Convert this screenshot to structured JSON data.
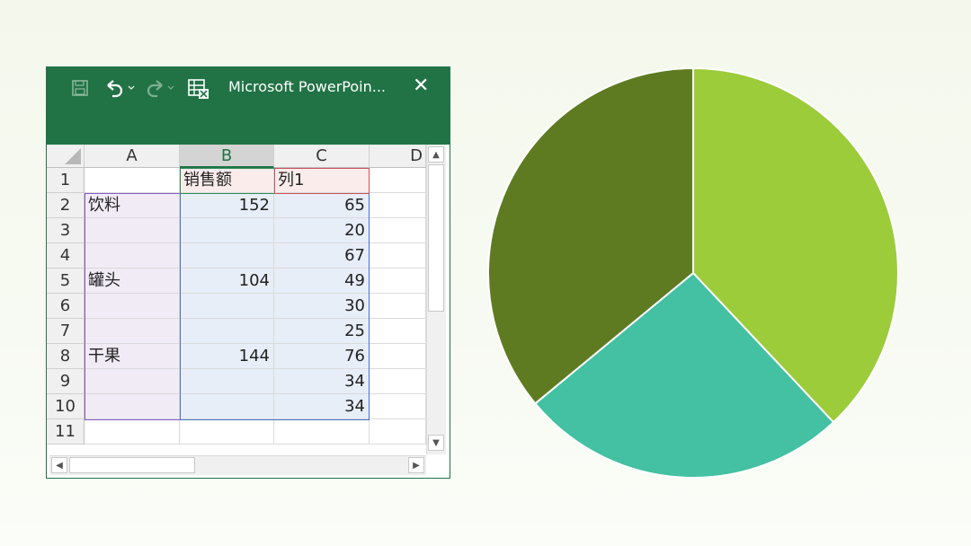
{
  "window": {
    "title": "Microsoft PowerPoin...",
    "accent_color": "#217346",
    "toolbar_icons": [
      "save-icon",
      "undo-icon",
      "redo-icon",
      "excel-sheet-icon"
    ],
    "close_glyph": "✕"
  },
  "sheet": {
    "column_headers": [
      "A",
      "B",
      "C",
      "D"
    ],
    "row_numbers": [
      "1",
      "2",
      "3",
      "4",
      "5",
      "6",
      "7",
      "8",
      "9",
      "10",
      "11"
    ],
    "rows": [
      [
        "",
        "销售额",
        "列1"
      ],
      [
        "饮料",
        "152",
        "65"
      ],
      [
        "",
        "",
        "20"
      ],
      [
        "",
        "",
        "67"
      ],
      [
        "罐头",
        "104",
        "49"
      ],
      [
        "",
        "",
        "30"
      ],
      [
        "",
        "",
        "25"
      ],
      [
        "干果",
        "144",
        "76"
      ],
      [
        "",
        "",
        "34"
      ],
      [
        "",
        "",
        "34"
      ],
      [
        "",
        "",
        ""
      ]
    ]
  },
  "chart_data": {
    "type": "pie",
    "categories": [
      "饮料",
      "罐头",
      "干果"
    ],
    "values": [
      152,
      104,
      144
    ],
    "colors": [
      "#9ccc3a",
      "#43c1a2",
      "#5e7b22"
    ],
    "title": ""
  }
}
